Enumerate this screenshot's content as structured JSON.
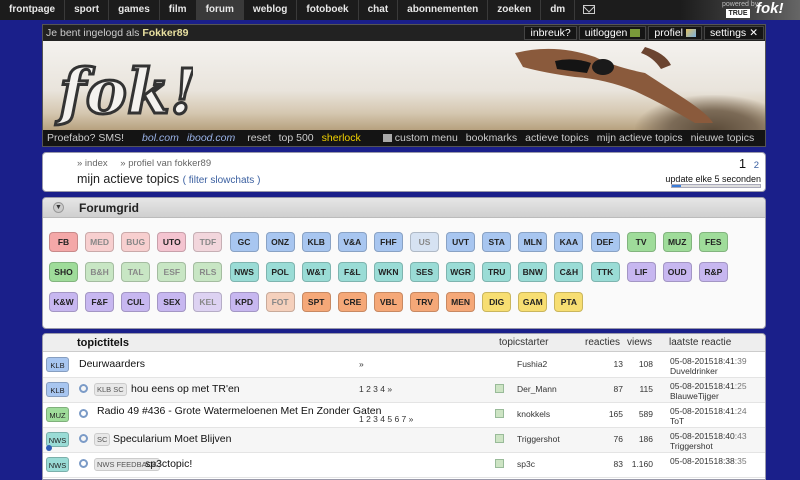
{
  "nav": {
    "items": [
      "frontpage",
      "sport",
      "games",
      "film",
      "forum",
      "weblog",
      "fotoboek",
      "chat",
      "abonnementen",
      "zoeken",
      "dm"
    ],
    "active": "forum",
    "powered_by": "powered by",
    "powered_brand": "TRUE",
    "logo_text": "fok!"
  },
  "banner": {
    "login_prefix": "Je bent ingelogd als",
    "username": "Fokker89",
    "logo": "fok!",
    "user_links": [
      "inbreuk?",
      "uitloggen",
      "profiel",
      "settings"
    ],
    "quick_links": [
      {
        "label": "Proefabo? SMS!",
        "style": "plain"
      },
      {
        "label": "bol.com",
        "style": "sponsor"
      },
      {
        "label": "ibood.com",
        "style": "sponsor"
      },
      {
        "label": "reset",
        "style": "plain"
      },
      {
        "label": "top 500",
        "style": "plain"
      },
      {
        "label": "sherlock",
        "style": "highlight"
      },
      {
        "label": "custom menu",
        "style": "plain"
      },
      {
        "label": "bookmarks",
        "style": "plain"
      },
      {
        "label": "actieve topics",
        "style": "plain"
      },
      {
        "label": "mijn actieve topics",
        "style": "plain"
      },
      {
        "label": "nieuwe topics",
        "style": "plain"
      }
    ]
  },
  "crumbs": {
    "items": [
      "» index",
      "» profiel van fokker89"
    ],
    "title": "mijn actieve topics",
    "filter": "( filter slowchats )",
    "pages": [
      "1",
      "2"
    ],
    "update_label": "update elke 5 seconden",
    "update_progress": 0.1
  },
  "forumgrid": {
    "title": "Forumgrid",
    "rows": [
      [
        [
          "FB",
          "#f4a8a8"
        ],
        [
          "MED",
          "#f7cfcf"
        ],
        [
          "BUG",
          "#f7cfcf"
        ],
        [
          "UTO",
          "#f4c4d0"
        ],
        [
          "TDF",
          "#f2d6dc"
        ],
        [
          "GC",
          "#a8c6f0"
        ],
        [
          "ONZ",
          "#a8c6f0"
        ],
        [
          "KLB",
          "#a8c6f0"
        ],
        [
          "V&A",
          "#a8c6f0"
        ],
        [
          "FHF",
          "#a8c6f0"
        ],
        [
          "US",
          "#d6e2f2"
        ],
        [
          "UVT",
          "#a8c6f0"
        ],
        [
          "STA",
          "#a8c6f0"
        ],
        [
          "MLN",
          "#a8c6f0"
        ],
        [
          "KAA",
          "#a8c6f0"
        ],
        [
          "DEF",
          "#a8c6f0"
        ],
        [
          "TV",
          "#9fdc9a"
        ],
        [
          "MUZ",
          "#9fdc9a"
        ],
        [
          "FES",
          "#9fdc9a"
        ]
      ],
      [
        [
          "SHO",
          "#9fdc9a"
        ],
        [
          "B&H",
          "#c8e6c4"
        ],
        [
          "TAL",
          "#c8e6c4"
        ],
        [
          "ESF",
          "#c8e6c4"
        ],
        [
          "RLS",
          "#c8e6c4"
        ],
        [
          "NWS",
          "#9adcd6"
        ],
        [
          "POL",
          "#9adcd6"
        ],
        [
          "W&T",
          "#9adcd6"
        ],
        [
          "F&L",
          "#9adcd6"
        ],
        [
          "WKN",
          "#9adcd6"
        ],
        [
          "SES",
          "#9adcd6"
        ],
        [
          "WGR",
          "#9adcd6"
        ],
        [
          "TRU",
          "#9adcd6"
        ],
        [
          "BNW",
          "#9adcd6"
        ],
        [
          "C&H",
          "#9adcd6"
        ],
        [
          "TTK",
          "#9adcd6"
        ],
        [
          "LIF",
          "#c7b7f0"
        ],
        [
          "OUD",
          "#c7b7f0"
        ],
        [
          "R&P",
          "#c7b7f0"
        ]
      ],
      [
        [
          "K&W",
          "#c7b7f0"
        ],
        [
          "F&F",
          "#c7b7f0"
        ],
        [
          "CUL",
          "#c7b7f0"
        ],
        [
          "SEX",
          "#c7b7f0"
        ],
        [
          "KEL",
          "#ddd2f2"
        ],
        [
          "KPD",
          "#c7b7f0"
        ],
        [
          "FOT",
          "#f5d0bc"
        ],
        [
          "SPT",
          "#f5a878"
        ],
        [
          "CRE",
          "#f5a878"
        ],
        [
          "VBL",
          "#f5a878"
        ],
        [
          "TRV",
          "#f5a878"
        ],
        [
          "MEN",
          "#f5a878"
        ],
        [
          "DIG",
          "#f7de72"
        ],
        [
          "GAM",
          "#f7de72"
        ],
        [
          "PTA",
          "#f7de72"
        ]
      ]
    ]
  },
  "topics": {
    "headers": {
      "title": "topictitels",
      "starter": "topicstarter",
      "replies": "reacties",
      "views": "views",
      "last": "laatste reactie"
    },
    "rows": [
      {
        "forum": "KLB",
        "color": "#a8c6f0",
        "sub": "",
        "title": "Deurwaarders",
        "pages": "»",
        "new": false,
        "starter": "Fushia2",
        "replies": "13",
        "views": "108",
        "date": "05-08-2015",
        "time": "18:41",
        "sec": ":39",
        "last_user": "Duveldrinker",
        "link": false,
        "info": false
      },
      {
        "forum": "KLB",
        "color": "#a8c6f0",
        "sub": "KLB SC",
        "title": "hou eens op met TR'en",
        "pages": "1 2 3 4 »",
        "new": true,
        "starter": "Der_Mann",
        "replies": "87",
        "views": "115",
        "date": "05-08-2015",
        "time": "18:41",
        "sec": ":25",
        "last_user": "BlauweTijger",
        "link": true,
        "info": false
      },
      {
        "forum": "MUZ",
        "color": "#9fdc9a",
        "sub": "",
        "title": "Radio 49 #436 - Grote Watermeloenen Met En Zonder Gaten",
        "pages": "1 2 3 4 5 6 7 »",
        "new": true,
        "starter": "knokkels",
        "replies": "165",
        "views": "589",
        "date": "05-08-2015",
        "time": "18:41",
        "sec": ":24",
        "last_user": "ToT",
        "link": true,
        "info": false
      },
      {
        "forum": "NWS",
        "color": "#9adcd6",
        "sub": "SC",
        "title": "Specularium Moet Blijven",
        "pages": "",
        "new": true,
        "starter": "Triggershot",
        "replies": "76",
        "views": "186",
        "date": "05-08-2015",
        "time": "18:40",
        "sec": ":43",
        "last_user": "Triggershot",
        "link": true,
        "info": true
      },
      {
        "forum": "NWS",
        "color": "#9adcd6",
        "sub": "NWS FEEDBACK",
        "title": "sp3ctopic!",
        "pages": "",
        "new": true,
        "starter": "sp3c",
        "replies": "83",
        "views": "1.160",
        "date": "05-08-2015",
        "time": "18:38",
        "sec": ":35",
        "last_user": "",
        "link": true,
        "info": false
      }
    ]
  }
}
